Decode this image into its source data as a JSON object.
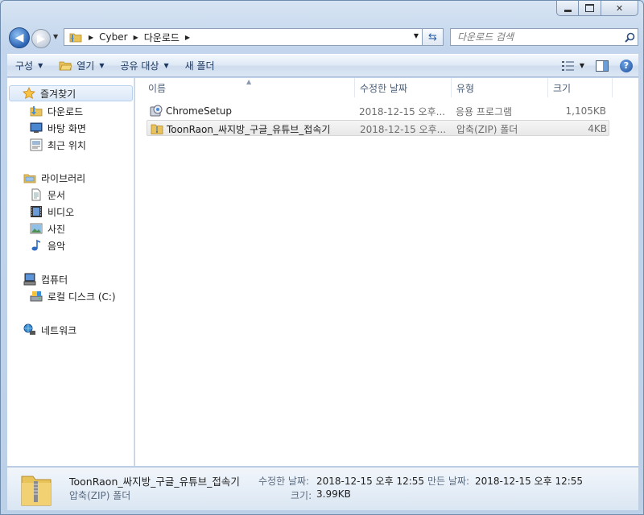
{
  "window": {
    "buttons": {
      "minimize": "minimize",
      "maximize": "maximize",
      "close": "✕"
    }
  },
  "address": {
    "crumbs": [
      "Cyber",
      "다운로드"
    ],
    "search_placeholder": "다운로드 검색"
  },
  "toolbar": {
    "organize": "구성",
    "open": "열기",
    "share": "공유 대상",
    "new_folder": "새 폴더",
    "help": "?"
  },
  "navpane": {
    "favorites": {
      "label": "즐겨찾기",
      "items": [
        "다운로드",
        "바탕 화면",
        "최근 위치"
      ]
    },
    "libraries": {
      "label": "라이브러리",
      "items": [
        "문서",
        "비디오",
        "사진",
        "음악"
      ]
    },
    "computer": {
      "label": "컴퓨터",
      "items": [
        "로컬 디스크 (C:)"
      ]
    },
    "network": {
      "label": "네트워크"
    }
  },
  "columns": [
    "이름",
    "수정한 날짜",
    "유형",
    "크기"
  ],
  "files": [
    {
      "name": "ChromeSetup",
      "date": "2018-12-15 오후...",
      "type": "응용 프로그램",
      "size": "1,105KB"
    },
    {
      "name": "ToonRaon_싸지방_구글_유튜브_접속기",
      "date": "2018-12-15 오후...",
      "type": "압축(ZIP) 폴더",
      "size": "4KB"
    }
  ],
  "details": {
    "name": "ToonRaon_싸지방_구글_유튜브_접속기",
    "type": "압축(ZIP) 폴더",
    "modified_label": "수정한 날짜:",
    "modified_value": "2018-12-15 오후 12:55",
    "created_label": "만든 날짜:",
    "created_value": "2018-12-15 오후 12:55",
    "size_label": "크기:",
    "size_value": "3.99KB"
  },
  "colors": {
    "accent": "#2b64b4",
    "selection": "#dbe8f8"
  }
}
